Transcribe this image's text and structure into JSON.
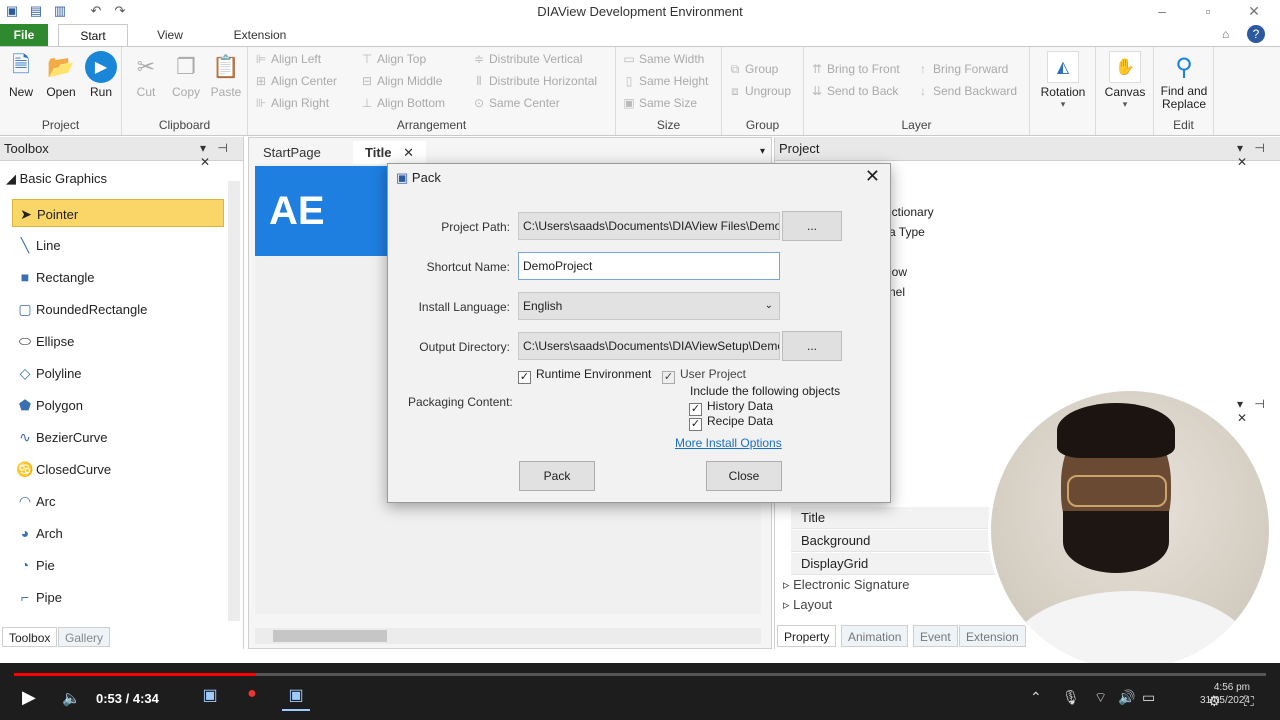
{
  "window": {
    "title": "DIAView Development Environment"
  },
  "menu": {
    "tabs": [
      "File",
      "Start",
      "View",
      "Extension"
    ]
  },
  "ribbon": {
    "project": {
      "label": "Project",
      "new": "New",
      "open": "Open",
      "run": "Run"
    },
    "clipboard": {
      "label": "Clipboard",
      "cut": "Cut",
      "copy": "Copy",
      "paste": "Paste"
    },
    "arrangement": {
      "label": "Arrangement",
      "align_left": "Align Left",
      "align_center": "Align Center",
      "align_right": "Align Right",
      "align_top": "Align Top",
      "align_middle": "Align Middle",
      "align_bottom": "Align Bottom",
      "dist_vertical": "Distribute Vertical",
      "dist_horizontal": "Distribute Horizontal",
      "same_center": "Same Center"
    },
    "size": {
      "label": "Size",
      "same_width": "Same Width",
      "same_height": "Same Height",
      "same_size": "Same Size"
    },
    "group": {
      "label": "Group",
      "group": "Group",
      "ungroup": "Ungroup"
    },
    "layer": {
      "label": "Layer",
      "bring_front": "Bring to Front",
      "send_back": "Send to Back",
      "bring_forward": "Bring Forward",
      "send_backward": "Send Backward"
    },
    "rotation": "Rotation",
    "canvas": "Canvas",
    "edit": {
      "label": "Edit",
      "find_line1": "Find and",
      "find_line2": "Replace"
    }
  },
  "toolbox": {
    "title": "Toolbox",
    "category": "Basic Graphics",
    "items": [
      "Pointer",
      "Line",
      "Rectangle",
      "RoundedRectangle",
      "Ellipse",
      "Polyline",
      "Polygon",
      "BezierCurve",
      "ClosedCurve",
      "Arc",
      "Arch",
      "Pie",
      "Pipe"
    ],
    "bottom_tabs": [
      "Toolbox",
      "Gallery"
    ]
  },
  "editor": {
    "tabs": [
      "StartPage",
      "Title"
    ],
    "logo_text": "AE"
  },
  "project_pane": {
    "title": "Project",
    "items": [
      "ictionary",
      "a Type",
      "low",
      "nel"
    ]
  },
  "props_pane": {
    "rows": [
      "Title",
      "Background",
      "DisplayGrid"
    ],
    "groups": [
      "Electronic Signature",
      "Layout"
    ],
    "tabs": [
      "Property",
      "Animation",
      "Event",
      "Extension"
    ]
  },
  "dialog": {
    "title": "Pack",
    "project_path_label": "Project Path:",
    "project_path": "C:\\Users\\saads\\Documents\\DIAView Files\\DemoP",
    "shortcut_label": "Shortcut Name:",
    "shortcut": "DemoProject",
    "language_label": "Install Language:",
    "language": "English",
    "output_label": "Output Directory:",
    "output": "C:\\Users\\saads\\Documents\\DIAViewSetup\\Demo",
    "browse": "...",
    "runtime_env": "Runtime Environment",
    "user_project": "User Project",
    "packaging_label": "Packaging Content:",
    "include_label": "Include the following objects",
    "history": "History Data",
    "recipe": "Recipe Data",
    "more": "More Install Options",
    "pack_btn": "Pack",
    "close_btn": "Close"
  },
  "player": {
    "time": "0:53 / 4:34",
    "progress": 0.193
  },
  "clock": {
    "time": "4:56 pm",
    "date": "31/05/2024"
  },
  "colors": {
    "file_tab": "#2f8a2f",
    "selected": "#f9d667",
    "progress": "#ff0000",
    "logo": "#1e7fe0"
  }
}
